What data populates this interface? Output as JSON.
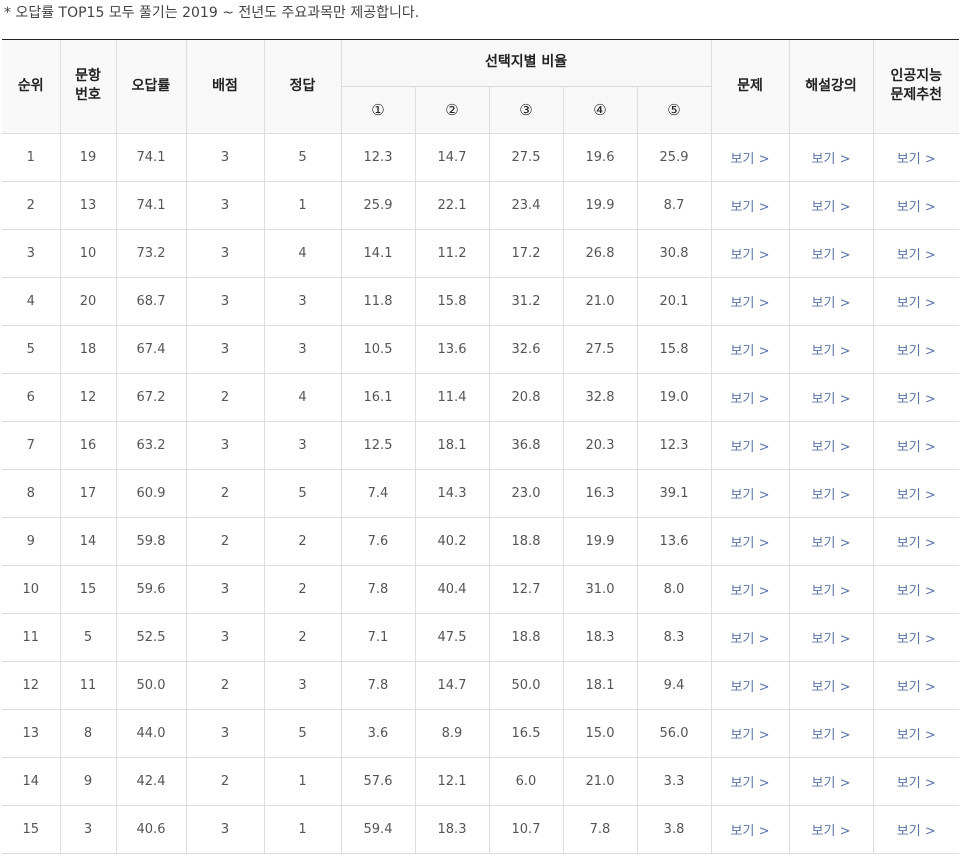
{
  "notice": "* 오답률 TOP15 모두 풀기는 2019 ~ 전년도 주요과목만 제공합니다.",
  "headers": {
    "rank": "순위",
    "qnum_line1": "문항",
    "qnum_line2": "번호",
    "error_rate": "오답률",
    "points": "배점",
    "answer": "정답",
    "choice_ratio": "선택지별 비율",
    "choices": [
      "①",
      "②",
      "③",
      "④",
      "⑤"
    ],
    "problem": "문제",
    "lecture": "해설강의",
    "ai_line1": "인공지능",
    "ai_line2": "문제추천"
  },
  "link_label": "보기 >",
  "rows": [
    {
      "rank": "1",
      "qnum": "19",
      "error_rate": "74.1",
      "points": "3",
      "answer": "5",
      "c1": "12.3",
      "c2": "14.7",
      "c3": "27.5",
      "c4": "19.6",
      "c5": "25.9"
    },
    {
      "rank": "2",
      "qnum": "13",
      "error_rate": "74.1",
      "points": "3",
      "answer": "1",
      "c1": "25.9",
      "c2": "22.1",
      "c3": "23.4",
      "c4": "19.9",
      "c5": "8.7"
    },
    {
      "rank": "3",
      "qnum": "10",
      "error_rate": "73.2",
      "points": "3",
      "answer": "4",
      "c1": "14.1",
      "c2": "11.2",
      "c3": "17.2",
      "c4": "26.8",
      "c5": "30.8"
    },
    {
      "rank": "4",
      "qnum": "20",
      "error_rate": "68.7",
      "points": "3",
      "answer": "3",
      "c1": "11.8",
      "c2": "15.8",
      "c3": "31.2",
      "c4": "21.0",
      "c5": "20.1"
    },
    {
      "rank": "5",
      "qnum": "18",
      "error_rate": "67.4",
      "points": "3",
      "answer": "3",
      "c1": "10.5",
      "c2": "13.6",
      "c3": "32.6",
      "c4": "27.5",
      "c5": "15.8"
    },
    {
      "rank": "6",
      "qnum": "12",
      "error_rate": "67.2",
      "points": "2",
      "answer": "4",
      "c1": "16.1",
      "c2": "11.4",
      "c3": "20.8",
      "c4": "32.8",
      "c5": "19.0"
    },
    {
      "rank": "7",
      "qnum": "16",
      "error_rate": "63.2",
      "points": "3",
      "answer": "3",
      "c1": "12.5",
      "c2": "18.1",
      "c3": "36.8",
      "c4": "20.3",
      "c5": "12.3"
    },
    {
      "rank": "8",
      "qnum": "17",
      "error_rate": "60.9",
      "points": "2",
      "answer": "5",
      "c1": "7.4",
      "c2": "14.3",
      "c3": "23.0",
      "c4": "16.3",
      "c5": "39.1"
    },
    {
      "rank": "9",
      "qnum": "14",
      "error_rate": "59.8",
      "points": "2",
      "answer": "2",
      "c1": "7.6",
      "c2": "40.2",
      "c3": "18.8",
      "c4": "19.9",
      "c5": "13.6"
    },
    {
      "rank": "10",
      "qnum": "15",
      "error_rate": "59.6",
      "points": "3",
      "answer": "2",
      "c1": "7.8",
      "c2": "40.4",
      "c3": "12.7",
      "c4": "31.0",
      "c5": "8.0"
    },
    {
      "rank": "11",
      "qnum": "5",
      "error_rate": "52.5",
      "points": "3",
      "answer": "2",
      "c1": "7.1",
      "c2": "47.5",
      "c3": "18.8",
      "c4": "18.3",
      "c5": "8.3"
    },
    {
      "rank": "12",
      "qnum": "11",
      "error_rate": "50.0",
      "points": "2",
      "answer": "3",
      "c1": "7.8",
      "c2": "14.7",
      "c3": "50.0",
      "c4": "18.1",
      "c5": "9.4"
    },
    {
      "rank": "13",
      "qnum": "8",
      "error_rate": "44.0",
      "points": "3",
      "answer": "5",
      "c1": "3.6",
      "c2": "8.9",
      "c3": "16.5",
      "c4": "15.0",
      "c5": "56.0"
    },
    {
      "rank": "14",
      "qnum": "9",
      "error_rate": "42.4",
      "points": "2",
      "answer": "1",
      "c1": "57.6",
      "c2": "12.1",
      "c3": "6.0",
      "c4": "21.0",
      "c5": "3.3"
    },
    {
      "rank": "15",
      "qnum": "3",
      "error_rate": "40.6",
      "points": "3",
      "answer": "1",
      "c1": "59.4",
      "c2": "18.3",
      "c3": "10.7",
      "c4": "7.8",
      "c5": "3.8"
    }
  ]
}
